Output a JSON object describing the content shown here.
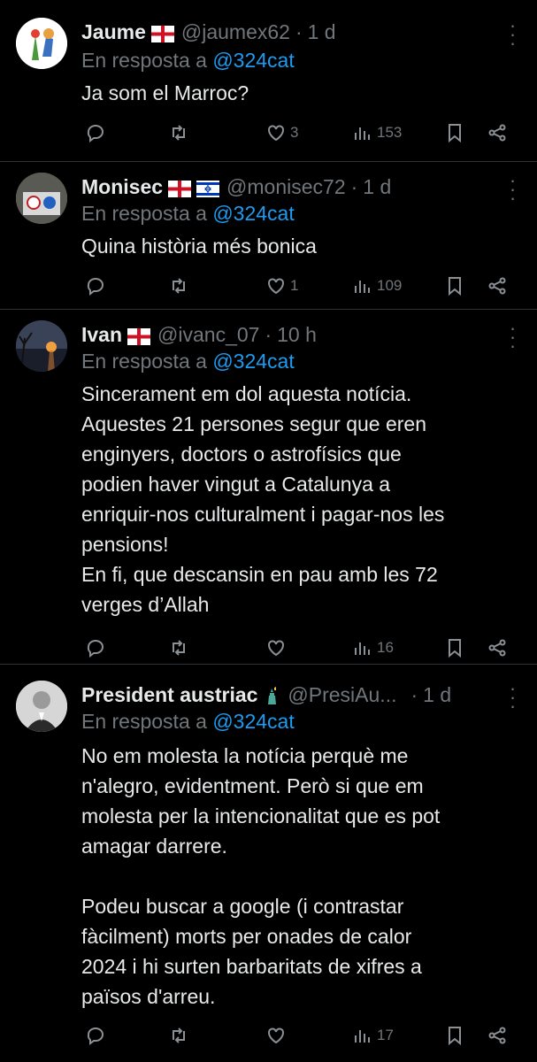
{
  "tweets": [
    {
      "name": "Jaume",
      "flags": [
        "england"
      ],
      "handle": "@jaumex62",
      "time": "1 d",
      "reply_prefix": "En resposta a",
      "reply_to": "@324cat",
      "text": "Ja som el Marroc?",
      "likes": "3",
      "views": "153"
    },
    {
      "name": "Monisec",
      "flags": [
        "england",
        "israel"
      ],
      "handle": "@monisec72",
      "time": "1 d",
      "reply_prefix": "En resposta a",
      "reply_to": "@324cat",
      "text": "Quina història més bonica",
      "likes": "1",
      "views": "109"
    },
    {
      "name": "Ivan",
      "flags": [
        "england"
      ],
      "handle": "@ivanc_07",
      "time": "10 h",
      "reply_prefix": "En resposta a",
      "reply_to": "@324cat",
      "text": "Sincerament em dol aquesta notícia.\nAquestes 21 persones segur que eren\nenginyers, doctors o astrofísics que\npodien haver vingut a Catalunya a\nenriquir-nos culturalment i pagar-nos les\npensions!\nEn fi, que descansin en pau amb les 72\nverges d’Allah",
      "likes": "",
      "views": "16"
    },
    {
      "name": "President austriac",
      "flags": [
        "statue"
      ],
      "handle": "@PresiAu...",
      "time": "1 d",
      "reply_prefix": "En resposta a",
      "reply_to": "@324cat",
      "text": "No em molesta la notícia perquè me\nn'alegro, evidentment. Però si que em\nmolesta per la intencionalitat que es pot\namagar darrere.\n\nPodeu buscar a google (i contrastar\nfàcilment) morts per onades de calor\n2024 i hi surten barbaritats de xifres a\npaïsos d'arreu.",
      "likes": "",
      "views": "17"
    }
  ],
  "colors": {
    "background": "#000000",
    "text": "#e7e9ea",
    "muted": "#71767b",
    "link": "#1d9bf0",
    "divider": "#2f3336"
  },
  "icons": [
    "reply-icon",
    "retweet-icon",
    "like-icon",
    "views-icon",
    "bookmark-icon",
    "share-icon",
    "more-icon"
  ]
}
